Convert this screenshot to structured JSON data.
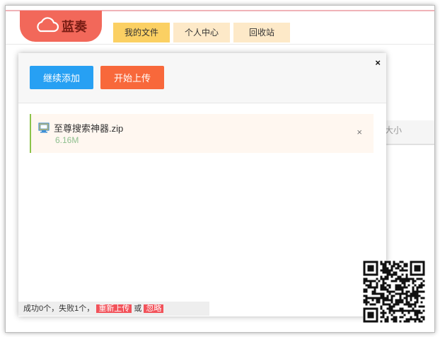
{
  "logo": {
    "text": "蓝奏",
    "icon": "cloud-icon"
  },
  "nav": {
    "tabs": [
      {
        "label": "我的文件",
        "active": true
      },
      {
        "label": "个人中心",
        "active": false
      },
      {
        "label": "回收站",
        "active": false
      }
    ]
  },
  "background": {
    "size_header": "大小"
  },
  "dialog": {
    "continue_add_label": "继续添加",
    "start_upload_label": "开始上传",
    "close_symbol": "×",
    "file": {
      "name": "至尊搜索神器.zip",
      "size": "6.16M",
      "remove_symbol": "×"
    },
    "status": {
      "text": "成功0个，失败1个，",
      "retry_label": "重新上传",
      "or_label": "或",
      "ignore_label": "忽略"
    }
  },
  "colors": {
    "logo_bg": "#f2685a",
    "tab_active": "#fbd063",
    "tab_inactive": "#fde9c8",
    "btn_add": "#27a0f3",
    "btn_upload": "#f8683b",
    "tag": "#f2525a"
  }
}
